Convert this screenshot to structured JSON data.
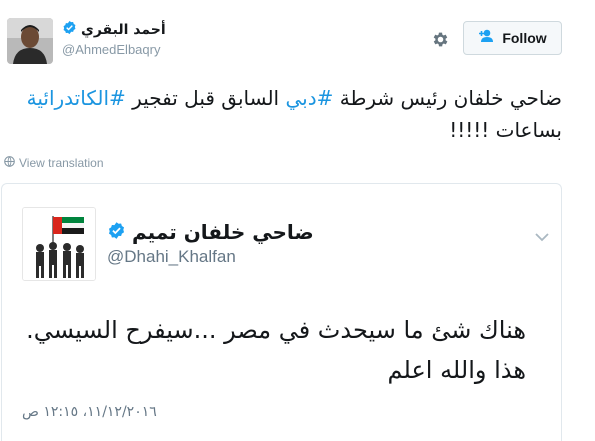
{
  "tweet": {
    "author_name": "أحمد البقري",
    "author_handle": "@AhmedElbaqry",
    "follow_label": "Follow",
    "text_segments": [
      {
        "type": "text",
        "value": "ضاحي خلفان رئيس شرطة "
      },
      {
        "type": "hashtag",
        "value": "#دبي"
      },
      {
        "type": "text",
        "value": " السابق قبل تفجير "
      },
      {
        "type": "hashtag",
        "value": "#الكاتدرائية"
      },
      {
        "type": "text",
        "value": " بساعات !!!!!"
      }
    ],
    "view_translation_label": "View translation"
  },
  "embedded": {
    "author_name": "ضاحي خلفان تميم",
    "author_handle": "@Dhahi_Khalfan",
    "line1": "هناك شئ ما سيحدث في مصر ...سيفرح السيسي.",
    "line2": "هذا والله اعلم",
    "date": "١١/١٢/٢٠١٦، ١٢:١٥ ص"
  },
  "icons": {
    "verified": "verified-badge-icon",
    "gear": "gear-icon",
    "follow": "add-user-icon",
    "globe": "globe-icon",
    "chevron": "chevron-down-icon"
  },
  "colors": {
    "link": "#1b95e0",
    "verified": "#1da1f2",
    "muted": "#8899a6"
  }
}
